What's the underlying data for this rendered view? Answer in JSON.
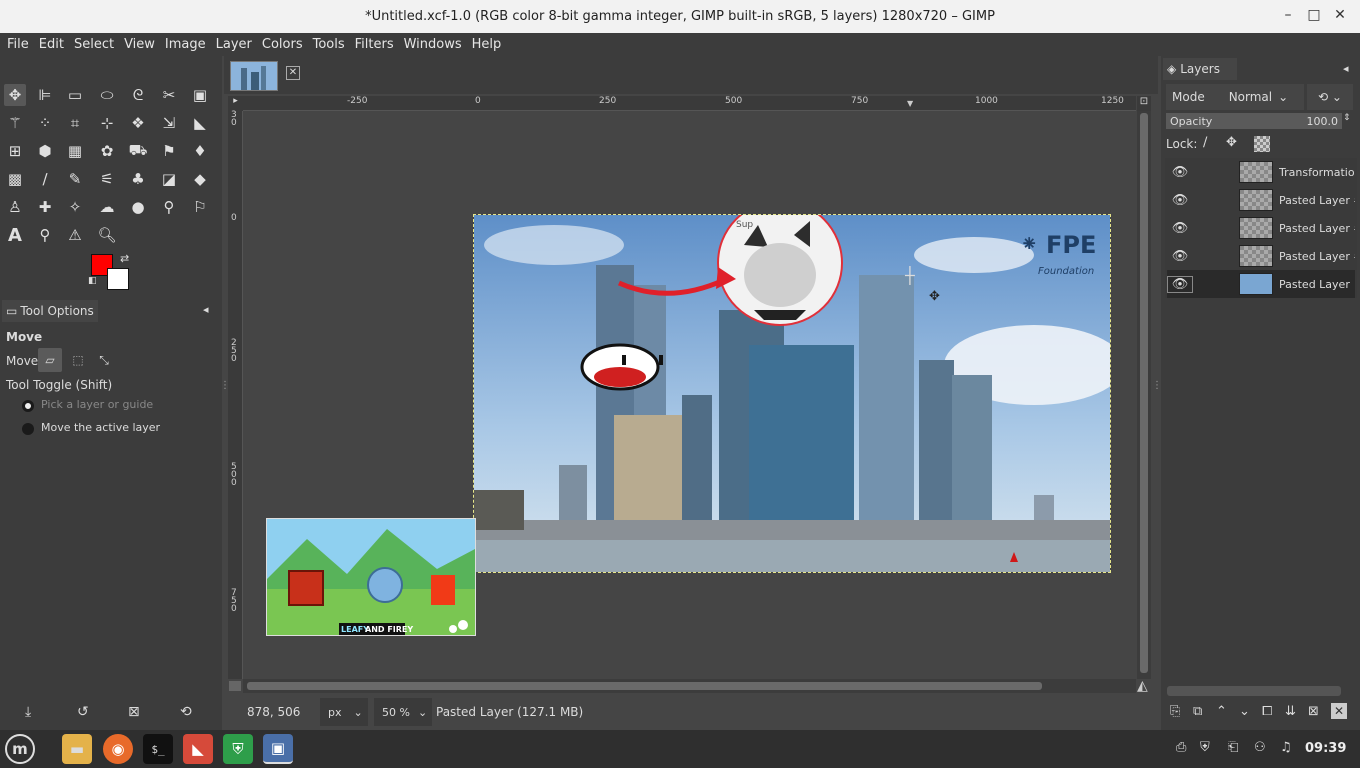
{
  "window": {
    "title": "*Untitled.xcf-1.0 (RGB color 8-bit gamma integer, GIMP built-in sRGB, 5 layers) 1280x720 – GIMP",
    "minimize": "–",
    "maximize": "□",
    "close": "✕"
  },
  "menubar": [
    "File",
    "Edit",
    "Select",
    "View",
    "Image",
    "Layer",
    "Colors",
    "Tools",
    "Filters",
    "Windows",
    "Help"
  ],
  "colors": {
    "foreground": "#ff0000",
    "background": "#ffffff"
  },
  "tool_options": {
    "tab_label": "Tool Options",
    "tool_name": "Move",
    "move_label": "Move:",
    "toggle_label": "Tool Toggle  (Shift)",
    "option_pick": "Pick a layer or guide",
    "option_move": "Move the active layer"
  },
  "rulers": {
    "top": [
      "-250",
      "0",
      "250",
      "500",
      "750",
      "1000",
      "1250"
    ],
    "left": [
      "0",
      "2\n5\n0",
      "5\n0\n0",
      "7\n5\n0"
    ]
  },
  "canvas_content": {
    "logo_text": "FPE",
    "logo_sub": "Foundation",
    "bubble_text": "Sup",
    "inset_caption_1": "LEAFY",
    "inset_caption_2": "AND FIREY"
  },
  "statusbar": {
    "coords": "878, 506",
    "unit": "px",
    "zoom": "50 %",
    "message": "Pasted Layer (127.1 MB)"
  },
  "layers": {
    "tab_label": "Layers",
    "mode_label": "Mode",
    "mode_value": "Normal",
    "opacity_label": "Opacity",
    "opacity_value": "100.0",
    "lock_label": "Lock:",
    "items": [
      {
        "name": "Transformation"
      },
      {
        "name": "Pasted Layer #"
      },
      {
        "name": "Pasted Layer #"
      },
      {
        "name": "Pasted Layer #"
      },
      {
        "name": "Pasted Layer"
      }
    ]
  },
  "taskbar": {
    "clock": "09:39"
  }
}
